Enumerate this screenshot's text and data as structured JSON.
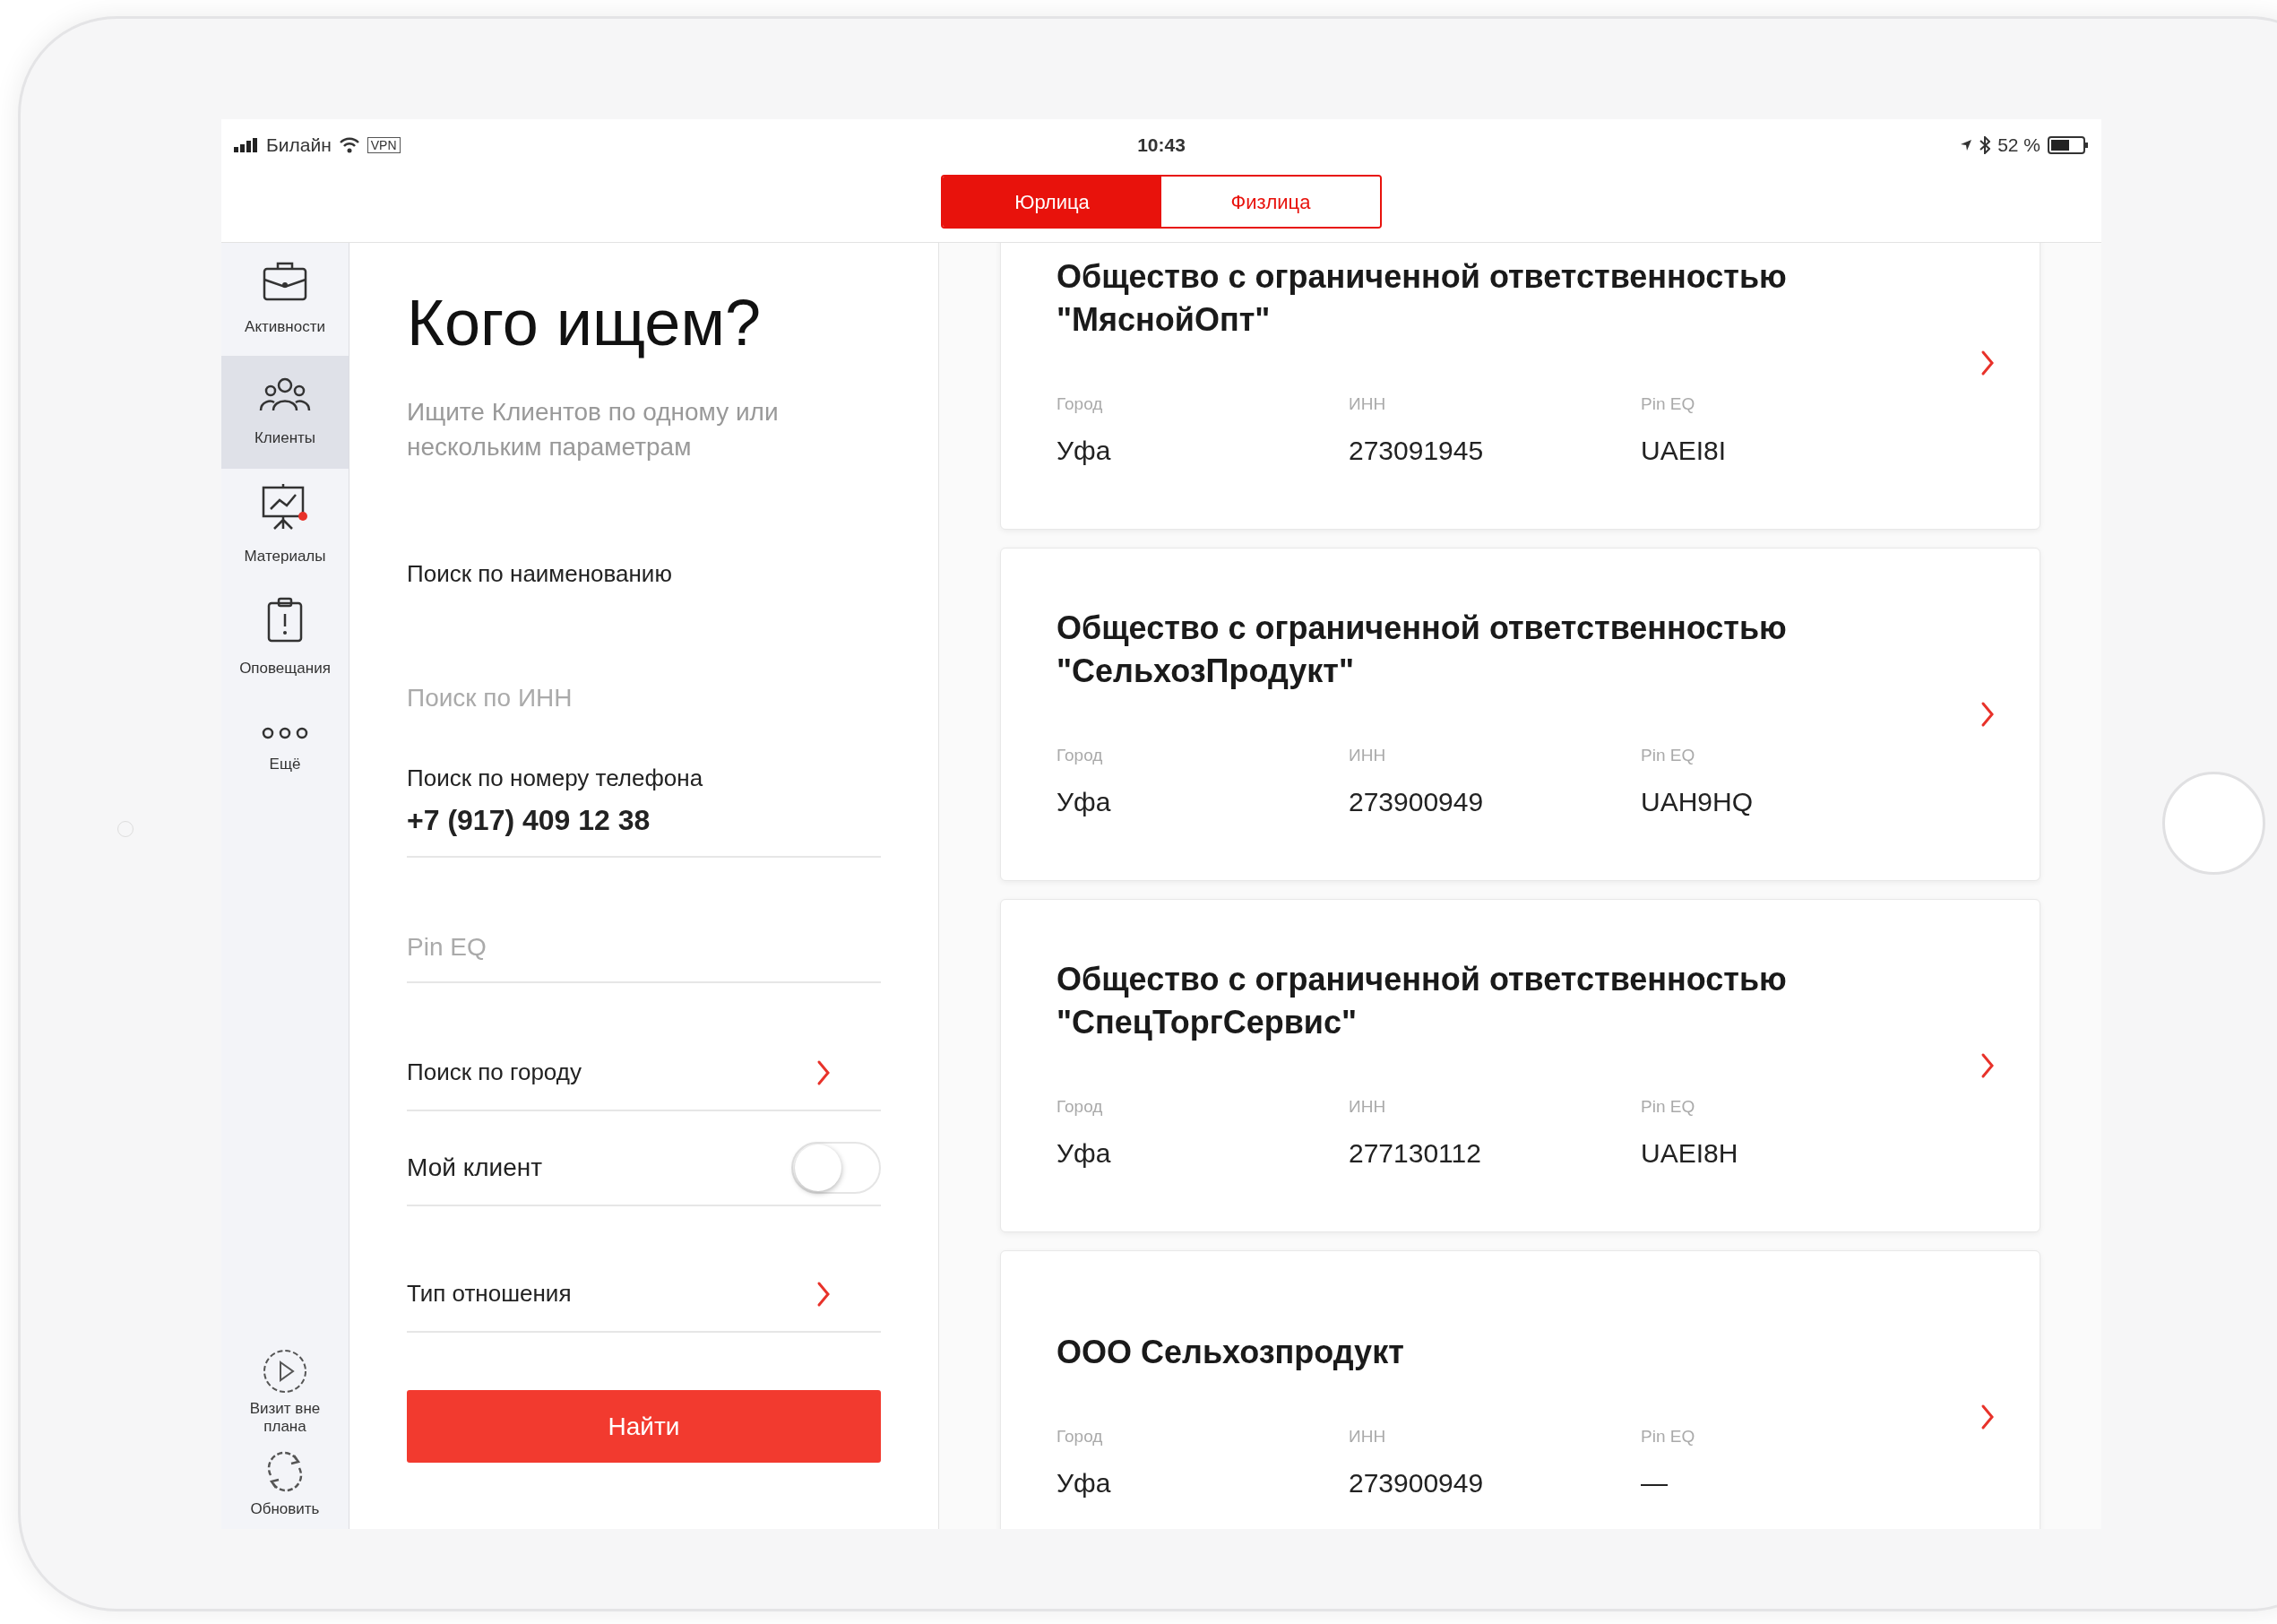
{
  "status_bar": {
    "carrier": "Билайн",
    "vpn": "VPN",
    "time": "10:43",
    "battery": "52 %"
  },
  "segments": [
    {
      "label": "Юрлица",
      "selected": true
    },
    {
      "label": "Физлица",
      "selected": false
    }
  ],
  "sidebar": {
    "items": [
      {
        "label": "Активности",
        "selected": false
      },
      {
        "label": "Клиенты",
        "selected": true
      },
      {
        "label": "Материалы",
        "selected": false
      },
      {
        "label": "Оповещания",
        "selected": false
      },
      {
        "label": "Ещё",
        "selected": false
      }
    ],
    "bottom_items": [
      {
        "label": "Визит вне плана"
      },
      {
        "label": "Обновить"
      }
    ]
  },
  "search": {
    "title": "Кого ищем?",
    "subtitle": "Ищите Клиентов по одному или нескольким параметрам",
    "fields": [
      {
        "kind": "heading",
        "label": "Поиск по наименованию"
      },
      {
        "kind": "hint",
        "placeholder": "Поиск по ИНН"
      },
      {
        "kind": "input",
        "label": "Поиск по номеру телефона",
        "value": "+7 (917) 409 12 38"
      },
      {
        "kind": "lined",
        "placeholder": "Pin EQ"
      },
      {
        "kind": "link",
        "label": "Поиск по городу"
      },
      {
        "kind": "toggle",
        "label": "Мой клиент",
        "on": false
      },
      {
        "kind": "link",
        "label": "Тип отношения"
      }
    ],
    "button": "Найти"
  },
  "results": [
    {
      "title": "Общество с ограниченной ответственностью \"МяснойОпт\"",
      "city_label": "Город",
      "city": "Уфа",
      "inn_label": "ИНН",
      "inn": "273091945",
      "pin_label": "Pin EQ",
      "pin": "UAEI8I"
    },
    {
      "title": "Общество с ограниченной ответственностью \"СельхозПродукт\"",
      "city_label": "Город",
      "city": "Уфа",
      "inn_label": "ИНН",
      "inn": "273900949",
      "pin_label": "Pin EQ",
      "pin": "UAH9HQ"
    },
    {
      "title": "Общество с ограниченной ответственностью \"СпецТоргСервис\"",
      "city_label": "Город",
      "city": "Уфа",
      "inn_label": "ИНН",
      "inn": "277130112",
      "pin_label": "Pin EQ",
      "pin": "UAEI8H"
    },
    {
      "title": "ООО Сельхозпродукт",
      "city_label": "Город",
      "city": "Уфа",
      "inn_label": "ИНН",
      "inn": "273900949",
      "pin_label": "Pin EQ",
      "pin": "—"
    }
  ]
}
